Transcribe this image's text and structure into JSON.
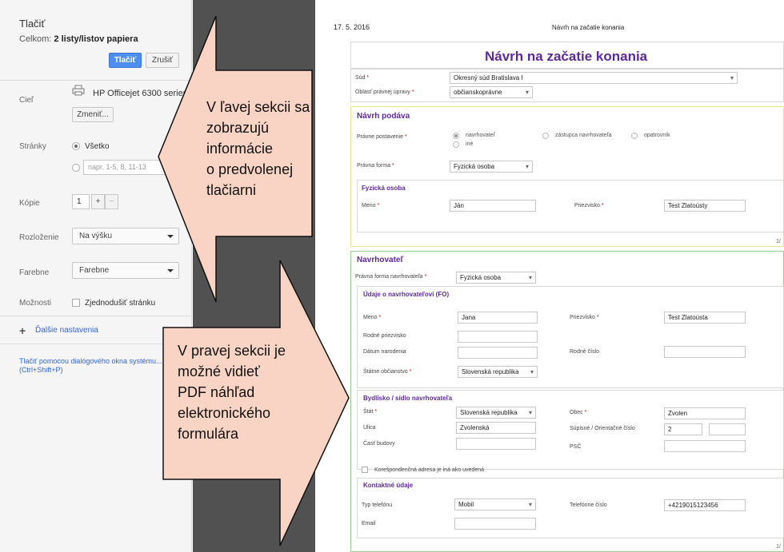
{
  "print_panel": {
    "title": "Tlačiť",
    "total_label": "Celkom:",
    "total_value": "2 listy/listov papiera",
    "print_button": "Tlačiť",
    "cancel_button": "Zrušiť",
    "destination_label": "Cieľ",
    "printer_name": "HP Officejet 6300 series",
    "change_button": "Zmeniť...",
    "pages_label": "Stránky",
    "pages_all": "Všetko",
    "pages_placeholder": "napr. 1-5, 8, 11-13",
    "copies_label": "Kópie",
    "copies_value": "1",
    "copies_plus": "+",
    "copies_minus": "−",
    "layout_label": "Rozloženie",
    "layout_value": "Na výšku",
    "color_label": "Farebne",
    "color_value": "Farebne",
    "options_label": "Možnosti",
    "simplify_label": "Zjednodušiť stránku",
    "more_settings": "Ďalšie nastavenia",
    "system_dialog": "Tlačiť pomocou dialógového okna systému... (Ctrl+Shift+P)"
  },
  "callouts": {
    "left": [
      "V ľavej sekcii sa",
      "zobrazujú",
      "informácie",
      "o predvolenej",
      "tlačiarni"
    ],
    "right": [
      "V pravej sekcii je",
      "možné vidieť",
      "PDF náhľad",
      "elektronického",
      "formulára"
    ],
    "fill_color": "#f9d4c4",
    "stroke_color": "#111111"
  },
  "preview": {
    "date": "17. 5. 2016",
    "header_title": "Návrh na začatie konania",
    "main_title": "Návrh na začatie konania",
    "court_label": "Súd",
    "court_value": "Okresný súd Bratislava I",
    "area_label": "Oblasť právnej úpravy",
    "area_value": "občianskoprávne",
    "submits_heading": "Návrh podáva",
    "legal_status_label": "Právne postavenie",
    "status_options": [
      "navrhovateľ",
      "zástupca navrhovateľa",
      "opatrovník",
      "iné"
    ],
    "legal_form_label": "Právna forma",
    "legal_form_value": "Fyzická osoba",
    "person_heading": "Fyzická osoba",
    "name_label": "Meno",
    "name_value": "Ján",
    "surname_label": "Priezvisko",
    "surname_value": "Test Zlatoústy",
    "page_no": "1/",
    "applicant_heading": "Navrhovateľ",
    "applicant_form_label": "Právna forma navrhovateľa",
    "applicant_form_value": "Fyzická osoba",
    "applicant_data_heading": "Údaje o navrhovateľovi (FO)",
    "a_name_label": "Meno",
    "a_name_value": "Jana",
    "a_surname_label": "Priezvisko",
    "a_surname_value": "Test Zlatoústa",
    "birth_surname_label": "Rodné priezvisko",
    "birth_date_label": "Dátum narodenia",
    "birth_number_label": "Rodné číslo",
    "citizenship_label": "Štátne občianstvo",
    "citizenship_value": "Slovenská republika",
    "address_heading": "Bydlisko / sídlo navrhovateľa",
    "state_label": "Štát",
    "state_value": "Slovenská republika",
    "town_label": "Obec",
    "town_value": "Zvolen",
    "street_label": "Ulica",
    "street_value": "Zvolenská",
    "numbers_label": "Súpisné / Orientačné číslo",
    "number_value": "2",
    "building_label": "Časť budovy",
    "zip_label": "PSČ",
    "corr_label": "Korešpondenčná adresa je iná ako uvedená",
    "contact_heading": "Kontaktné údaje",
    "phone_type_label": "Typ telefónu",
    "phone_type_value": "Mobil",
    "phone_label": "Telefónne číslo",
    "phone_value": "+4219015123456",
    "email_label": "Email",
    "page_no_2": "1/"
  }
}
